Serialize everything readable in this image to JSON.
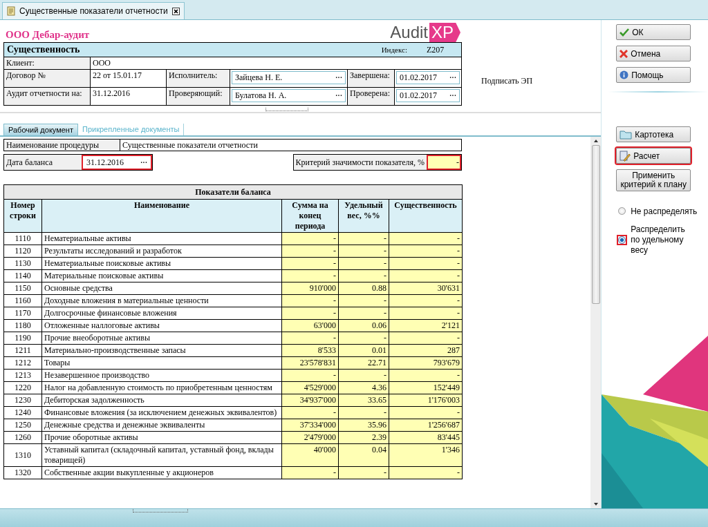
{
  "window_tab": {
    "title": "Существенные показатели отчетности"
  },
  "company": "ООО Дебар-аудит",
  "logo": {
    "text": "Audit",
    "accent": "XP"
  },
  "header": {
    "title": "Существенность",
    "index_label": "Индекс:",
    "index_value": "Z207",
    "client_label": "Клиент:",
    "client_value": "ООО",
    "rows": [
      {
        "label": "Договор №",
        "value": "22 от 15.01.17",
        "person_label": "Исполнитель:",
        "person": "Зайцева Н. Е.",
        "person_button": "···",
        "date_label": "Завершена:",
        "date": "01.02.2017",
        "date_button": "···"
      },
      {
        "label": "Аудит отчетности на:",
        "value": "31.12.2016",
        "person_label": "Проверяющий:",
        "person": "Булатова  Н. А.",
        "person_button": "···",
        "date_label": "Проверена:",
        "date": "01.02.2017",
        "date_button": "···"
      }
    ]
  },
  "sign_label": "Подписать ЭП",
  "doc_tabs": [
    {
      "label": "Рабочий документ",
      "selected": true
    },
    {
      "label": "Прикрепленные документы",
      "selected": false
    }
  ],
  "procedure": {
    "label": "Наименование процедуры",
    "value": "Существенные показатели отчетности"
  },
  "balance_date": {
    "label": "Дата баланса",
    "value": "31.12.2016",
    "button": "···",
    "highlighted": true
  },
  "criterion": {
    "label": "Критерий значимости показателя, %",
    "value": "-",
    "highlighted": true
  },
  "table": {
    "title": "Показатели баланса",
    "columns": [
      "Номер строки",
      "Наименование",
      "Сумма на конец периода",
      "Удельный вес, %%",
      "Существенность"
    ],
    "rows": [
      {
        "code": "1110",
        "name": "Нематериальные активы",
        "amount": "-",
        "weight": "-",
        "materiality": "-"
      },
      {
        "code": "1120",
        "name": "Результаты исследований и разработок",
        "amount": "-",
        "weight": "-",
        "materiality": "-"
      },
      {
        "code": "1130",
        "name": "Нематериальные поисковые активы",
        "amount": "-",
        "weight": "-",
        "materiality": "-"
      },
      {
        "code": "1140",
        "name": "Материальные поисковые активы",
        "amount": "-",
        "weight": "-",
        "materiality": "-"
      },
      {
        "code": "1150",
        "name": "Основные средства",
        "amount": "910'000",
        "weight": "0.88",
        "materiality": "30'631"
      },
      {
        "code": "1160",
        "name": "Доходные вложения в материальные ценности",
        "amount": "-",
        "weight": "-",
        "materiality": "-"
      },
      {
        "code": "1170",
        "name": "Долгосрочные финансовые вложения",
        "amount": "-",
        "weight": "-",
        "materiality": "-"
      },
      {
        "code": "1180",
        "name": "Отложенные наллоговые активы",
        "amount": "63'000",
        "weight": "0.06",
        "materiality": "2'121"
      },
      {
        "code": "1190",
        "name": "Прочие внеоборотные активы",
        "amount": "-",
        "weight": "-",
        "materiality": "-"
      },
      {
        "code": "1211",
        "name": "Материально-производственные запасы",
        "amount": "8'533",
        "weight": "0.01",
        "materiality": "287"
      },
      {
        "code": "1212",
        "name": "Товары",
        "amount": "23'578'831",
        "weight": "22.71",
        "materiality": "793'679"
      },
      {
        "code": "1213",
        "name": "Незавершенное производство",
        "amount": "-",
        "weight": "-",
        "materiality": "-"
      },
      {
        "code": "1220",
        "name": "Налог на добавленную стоимость по приобретенным ценностям",
        "amount": "4'529'000",
        "weight": "4.36",
        "materiality": "152'449"
      },
      {
        "code": "1230",
        "name": "Дебиторская задолженность",
        "amount": "34'937'000",
        "weight": "33.65",
        "materiality": "1'176'003"
      },
      {
        "code": "1240",
        "name": "Финансовые вложения (за исключением денежных эквивалентов)",
        "amount": "-",
        "weight": "-",
        "materiality": "-"
      },
      {
        "code": "1250",
        "name": "Денежные средства и денежные эквиваленты",
        "amount": "37'334'000",
        "weight": "35.96",
        "materiality": "1'256'687"
      },
      {
        "code": "1260",
        "name": "Прочие оборотные активы",
        "amount": "2'479'000",
        "weight": "2.39",
        "materiality": "83'445"
      },
      {
        "code": "1310",
        "name": "Уставный капитал (складочный капитал, уставный фонд, вклады товарищей)",
        "amount": "40'000",
        "weight": "0.04",
        "materiality": "1'346"
      },
      {
        "code": "1320",
        "name": "Собственные акции выкупленные у акционеров",
        "amount": "-",
        "weight": "-",
        "materiality": "-"
      }
    ]
  },
  "dialog_buttons": [
    {
      "label": "ОК",
      "kind": "confirm"
    },
    {
      "label": "Отмена",
      "kind": "cancel"
    },
    {
      "label": "Помощь",
      "kind": "help"
    }
  ],
  "side_buttons": [
    {
      "label": "Картотека",
      "kind": "catalog",
      "highlighted": false
    },
    {
      "label": "Расчет",
      "kind": "calculate",
      "highlighted": true
    },
    {
      "label": "Применить критерий к плану",
      "kind": "plain",
      "highlighted": false
    }
  ],
  "radios": [
    {
      "label": "Не распределять",
      "selected": false,
      "highlighted": false
    },
    {
      "label": "Распределить по удельному весу",
      "selected": true,
      "highlighted": true
    }
  ]
}
